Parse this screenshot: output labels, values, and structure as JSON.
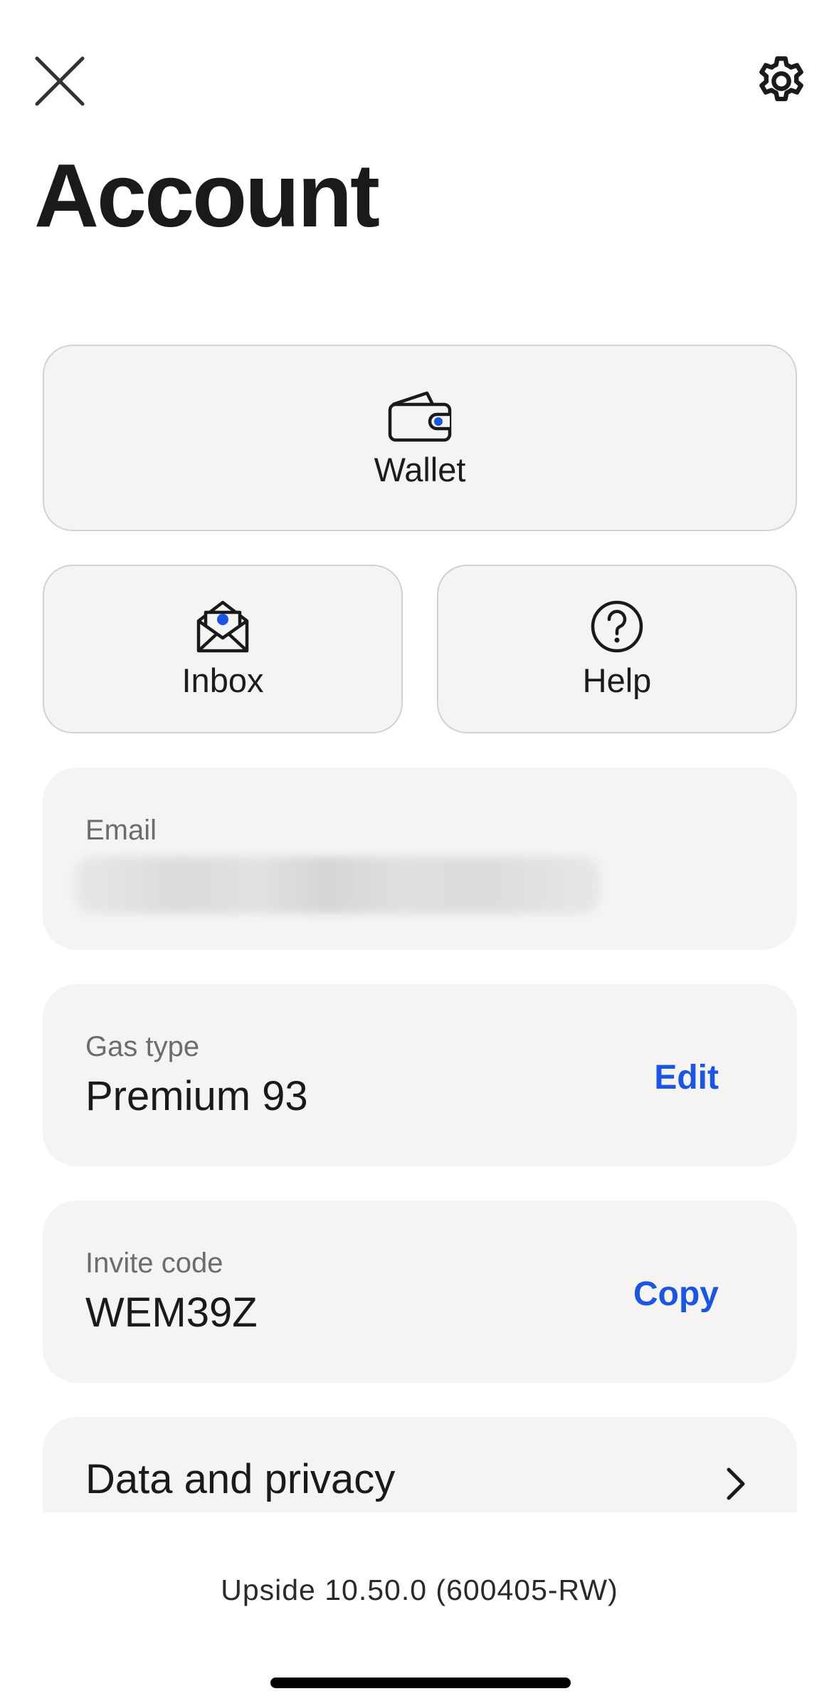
{
  "header": {
    "title": "Account",
    "close_icon": "close-icon",
    "settings_icon": "gear-icon"
  },
  "tiles": {
    "wallet": {
      "label": "Wallet",
      "icon": "wallet-icon"
    },
    "inbox": {
      "label": "Inbox",
      "icon": "envelope-icon"
    },
    "help": {
      "label": "Help",
      "icon": "question-circle-icon"
    }
  },
  "email": {
    "label": "Email",
    "value_redacted": true
  },
  "gas": {
    "label": "Gas type",
    "value": "Premium 93",
    "action": "Edit"
  },
  "invite": {
    "label": "Invite code",
    "value": "WEM39Z",
    "action": "Copy"
  },
  "privacy": {
    "label": "Data and privacy",
    "icon": "chevron-right-icon"
  },
  "footer": {
    "version": "Upside 10.50.0 (600405-RW)"
  },
  "colors": {
    "accent": "#1a55e6",
    "card_bg": "#f5f4f3",
    "tile_border": "#d3d2cf",
    "muted_text": "#6d6c6a"
  }
}
